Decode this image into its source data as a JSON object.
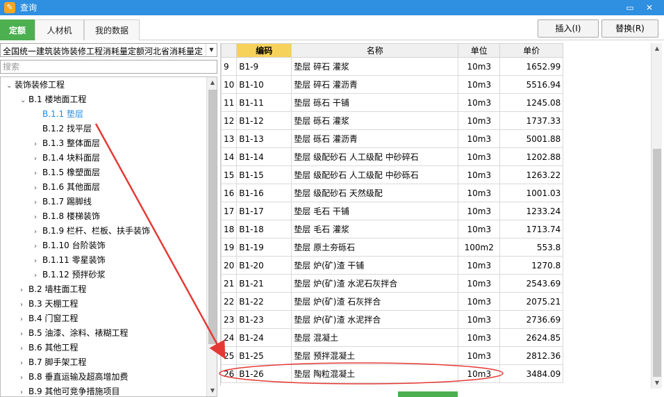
{
  "window": {
    "title": "查询",
    "maximize_icon": "maximize-icon",
    "close_icon": "close-icon"
  },
  "tabs": [
    {
      "label": "定额",
      "active": true
    },
    {
      "label": "人材机",
      "active": false
    },
    {
      "label": "我的数据",
      "active": false
    }
  ],
  "toolbar": {
    "insert_label": "插入(I)",
    "replace_label": "替换(R)"
  },
  "left": {
    "quota_select": "全国统一建筑装饰装修工程消耗量定额河北省消耗量定",
    "search_placeholder": "搜索",
    "tree": [
      {
        "label": "装饰装修工程",
        "level": 0,
        "state": "expanded"
      },
      {
        "label": "B.1 楼地面工程",
        "level": 1,
        "state": "expanded"
      },
      {
        "label": "B.1.1 垫层",
        "level": 2,
        "state": "leaf",
        "selected": true
      },
      {
        "label": "B.1.2 找平层",
        "level": 2,
        "state": "leaf"
      },
      {
        "label": "B.1.3 整体面层",
        "level": 2,
        "state": "collapsed"
      },
      {
        "label": "B.1.4 块料面层",
        "level": 2,
        "state": "collapsed"
      },
      {
        "label": "B.1.5 橡塑面层",
        "level": 2,
        "state": "collapsed"
      },
      {
        "label": "B.1.6 其他面层",
        "level": 2,
        "state": "collapsed"
      },
      {
        "label": "B.1.7 踢脚线",
        "level": 2,
        "state": "collapsed"
      },
      {
        "label": "B.1.8 楼梯装饰",
        "level": 2,
        "state": "collapsed"
      },
      {
        "label": "B.1.9 栏杆、栏板、扶手装饰",
        "level": 2,
        "state": "collapsed"
      },
      {
        "label": "B.1.10 台阶装饰",
        "level": 2,
        "state": "collapsed"
      },
      {
        "label": "B.1.11 零星装饰",
        "level": 2,
        "state": "collapsed"
      },
      {
        "label": "B.1.12 预拌砂浆",
        "level": 2,
        "state": "collapsed"
      },
      {
        "label": "B.2 墙柱面工程",
        "level": 1,
        "state": "collapsed"
      },
      {
        "label": "B.3 天棚工程",
        "level": 1,
        "state": "collapsed"
      },
      {
        "label": "B.4 门窗工程",
        "level": 1,
        "state": "collapsed"
      },
      {
        "label": "B.5 油漆、涂料、裱糊工程",
        "level": 1,
        "state": "collapsed"
      },
      {
        "label": "B.6 其他工程",
        "level": 1,
        "state": "collapsed"
      },
      {
        "label": "B.7 脚手架工程",
        "level": 1,
        "state": "collapsed"
      },
      {
        "label": "B.8 垂直运输及超高增加费",
        "level": 1,
        "state": "collapsed"
      },
      {
        "label": "B.9 其他可竞争措施项目",
        "level": 1,
        "state": "collapsed"
      }
    ]
  },
  "grid": {
    "columns": [
      "",
      "编码",
      "名称",
      "单位",
      "单价"
    ],
    "rows": [
      {
        "no": "9",
        "code": "B1-9",
        "name": "垫层 碎石 灌浆",
        "unit": "10m3",
        "price": "1652.99"
      },
      {
        "no": "10",
        "code": "B1-10",
        "name": "垫层 碎石 灌沥青",
        "unit": "10m3",
        "price": "5516.94"
      },
      {
        "no": "11",
        "code": "B1-11",
        "name": "垫层 砾石 干铺",
        "unit": "10m3",
        "price": "1245.08"
      },
      {
        "no": "12",
        "code": "B1-12",
        "name": "垫层 砾石 灌浆",
        "unit": "10m3",
        "price": "1737.33"
      },
      {
        "no": "13",
        "code": "B1-13",
        "name": "垫层 砾石 灌沥青",
        "unit": "10m3",
        "price": "5001.88"
      },
      {
        "no": "14",
        "code": "B1-14",
        "name": "垫层 级配砂石 人工级配 中砂碎石",
        "unit": "10m3",
        "price": "1202.88"
      },
      {
        "no": "15",
        "code": "B1-15",
        "name": "垫层 级配砂石 人工级配 中砂砾石",
        "unit": "10m3",
        "price": "1263.22"
      },
      {
        "no": "16",
        "code": "B1-16",
        "name": "垫层 级配砂石 天然级配",
        "unit": "10m3",
        "price": "1001.03"
      },
      {
        "no": "17",
        "code": "B1-17",
        "name": "垫层 毛石 干铺",
        "unit": "10m3",
        "price": "1233.24"
      },
      {
        "no": "18",
        "code": "B1-18",
        "name": "垫层 毛石 灌浆",
        "unit": "10m3",
        "price": "1713.74"
      },
      {
        "no": "19",
        "code": "B1-19",
        "name": "垫层 原土夯砾石",
        "unit": "100m2",
        "price": "553.8"
      },
      {
        "no": "20",
        "code": "B1-20",
        "name": "垫层 炉(矿)渣 干铺",
        "unit": "10m3",
        "price": "1270.8"
      },
      {
        "no": "21",
        "code": "B1-21",
        "name": "垫层 炉(矿)渣 水泥石灰拌合",
        "unit": "10m3",
        "price": "2543.69"
      },
      {
        "no": "22",
        "code": "B1-22",
        "name": "垫层 炉(矿)渣 石灰拌合",
        "unit": "10m3",
        "price": "2075.21"
      },
      {
        "no": "23",
        "code": "B1-23",
        "name": "垫层 炉(矿)渣 水泥拌合",
        "unit": "10m3",
        "price": "2736.69"
      },
      {
        "no": "24",
        "code": "B1-24",
        "name": "垫层 混凝土",
        "unit": "10m3",
        "price": "2624.85"
      },
      {
        "no": "25",
        "code": "B1-25",
        "name": "垫层 预拌混凝土",
        "unit": "10m3",
        "price": "2812.36"
      },
      {
        "no": "26",
        "code": "B1-26",
        "name": "垫层 陶粒混凝土",
        "unit": "10m3",
        "price": "3484.09",
        "highlighted": true
      }
    ]
  },
  "colors": {
    "titlebar": "#2f8fe0",
    "active_tab": "#4caf50",
    "code_header": "#f6d25a",
    "selected_tree": "#1e88e5",
    "annotation": "#e53935"
  }
}
